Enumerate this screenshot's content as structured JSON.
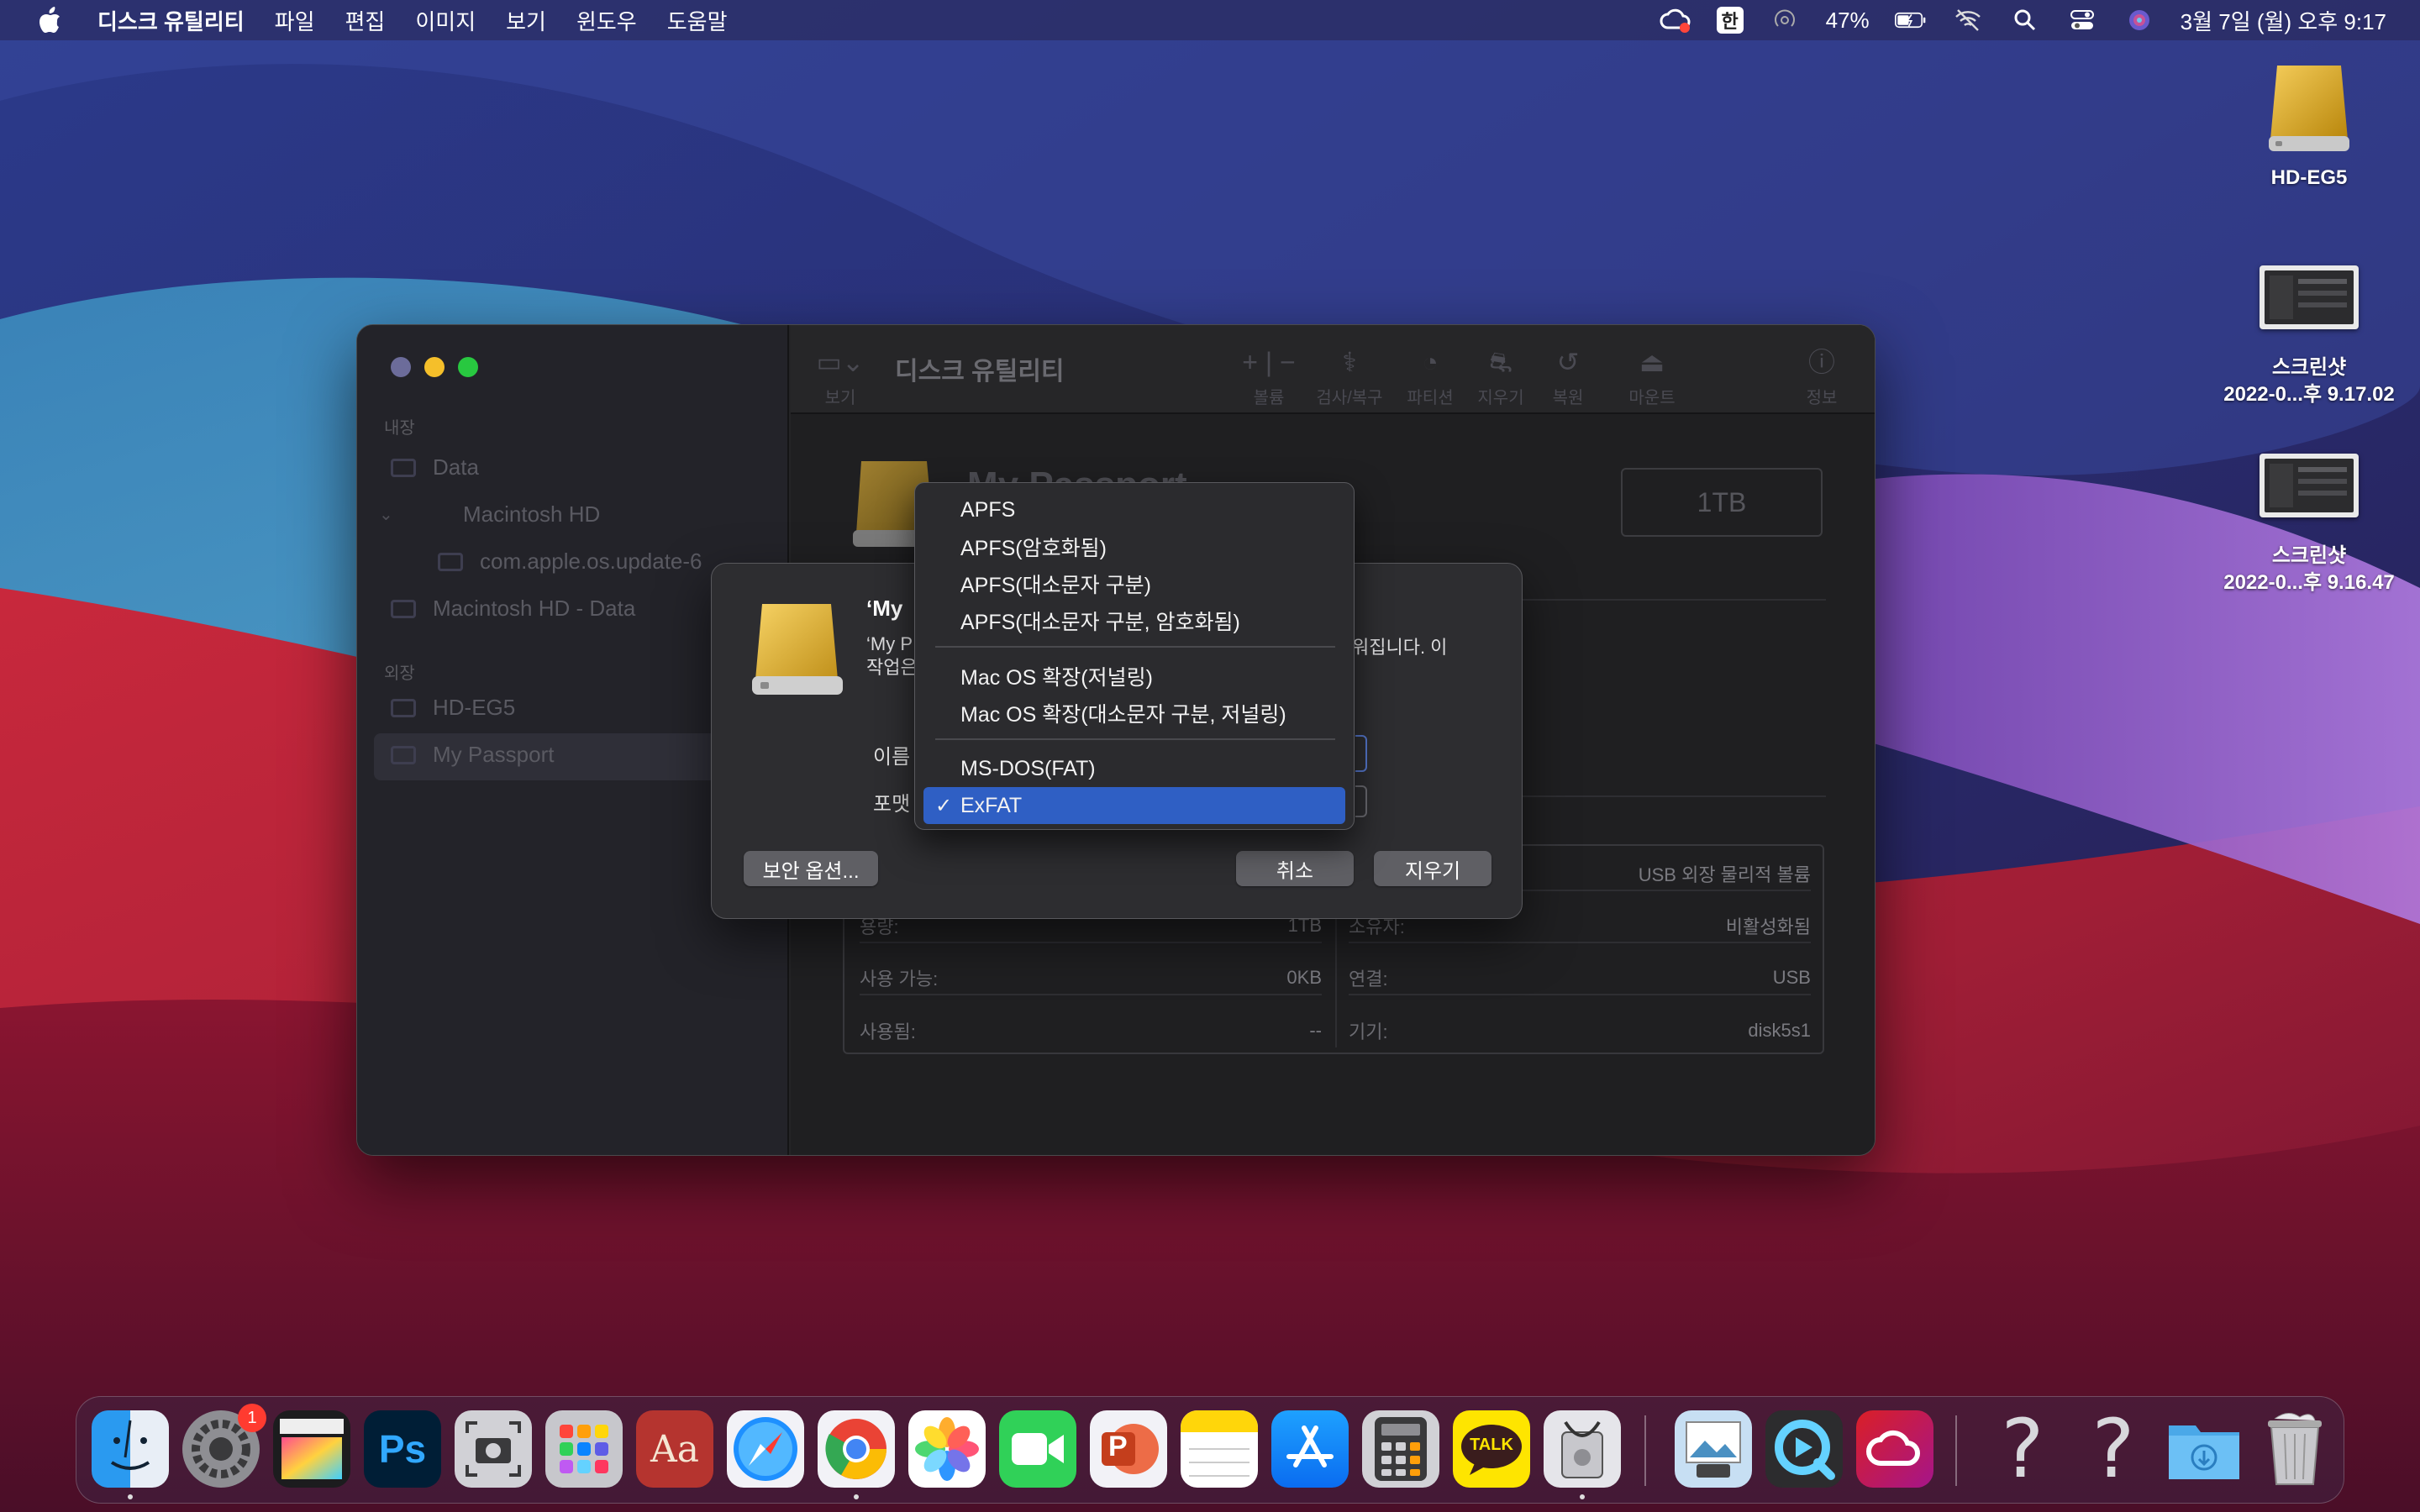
{
  "menubar": {
    "app_name": "디스크 유틸리티",
    "menus": [
      "파일",
      "편집",
      "이미지",
      "보기",
      "윈도우",
      "도움말"
    ],
    "ime_label": "한",
    "battery_percent": "47%",
    "clock": "3월 7일 (월) 오후 9:17"
  },
  "desktop": {
    "icons": [
      {
        "label": "HD-EG5",
        "icon": "external-drive-icon"
      },
      {
        "label_line1": "스크린샷",
        "label_line2": "2022-0...후 9.17.02",
        "icon": "screenshot-file-icon"
      },
      {
        "label_line1": "스크린샷",
        "label_line2": "2022-0...후 9.16.47",
        "icon": "screenshot-file-icon"
      }
    ]
  },
  "window": {
    "title": "디스크 유틸리티",
    "toolbar": {
      "view_label": "보기",
      "volume_label": "볼륨",
      "first_aid_label": "검사/복구",
      "partition_label": "파티션",
      "erase_label": "지우기",
      "restore_label": "복원",
      "mount_label": "마운트",
      "info_label": "정보"
    },
    "sidebar": {
      "internal_section": "내장",
      "external_section": "외장",
      "items": [
        {
          "label": "Data"
        },
        {
          "label": "Macintosh HD"
        },
        {
          "label": "com.apple.os.update-6"
        },
        {
          "label": "Macintosh HD - Data"
        },
        {
          "label": "HD-EG5"
        },
        {
          "label": "My Passport"
        }
      ]
    },
    "volume": {
      "name": "My Passport",
      "capacity": "1TB"
    },
    "info": {
      "left": [
        {
          "label": "용량:",
          "value": "1TB"
        },
        {
          "label": "사용 가능:",
          "value": "0KB"
        },
        {
          "label": "사용됨:",
          "value": "--"
        }
      ],
      "right": [
        {
          "label": "",
          "value": "USB 외장 물리적 볼륨"
        },
        {
          "label": "소유자:",
          "value": "비활성화됨"
        },
        {
          "label": "연결:",
          "value": "USB"
        },
        {
          "label": "기기:",
          "value": "disk5s1"
        }
      ]
    }
  },
  "erase_sheet": {
    "title": "‘My",
    "desc_line1": "‘My P",
    "desc_line2": "작업은",
    "desc_tail": "워집니다. 이",
    "name_label": "이름",
    "format_label": "포맷",
    "security_button": "보안 옵션...",
    "cancel_button": "취소",
    "erase_button": "지우기"
  },
  "format_menu": {
    "groups": [
      [
        "APFS",
        "APFS(암호화됨)",
        "APFS(대소문자 구분)",
        "APFS(대소문자 구분, 암호화됨)"
      ],
      [
        "Mac OS 확장(저널링)",
        "Mac OS 확장(대소문자 구분, 저널링)"
      ],
      [
        "MS-DOS(FAT)",
        "ExFAT"
      ]
    ],
    "selected": "ExFAT",
    "check": "✓"
  },
  "dock": {
    "apps": [
      {
        "name": "Finder",
        "icon": "finder-icon"
      },
      {
        "name": "System Preferences",
        "icon": "settings-icon",
        "badge": "1"
      },
      {
        "name": "Final Cut Pro",
        "icon": "final-cut-icon"
      },
      {
        "name": "Photoshop",
        "icon": "photoshop-icon",
        "text": "Ps"
      },
      {
        "name": "Screenshot",
        "icon": "screenshot-icon"
      },
      {
        "name": "Launchpad",
        "icon": "launchpad-icon"
      },
      {
        "name": "Dictionary",
        "icon": "dictionary-icon",
        "text": "Aa"
      },
      {
        "name": "Safari",
        "icon": "safari-icon"
      },
      {
        "name": "Chrome",
        "icon": "chrome-icon"
      },
      {
        "name": "Photos",
        "icon": "photos-icon"
      },
      {
        "name": "FaceTime",
        "icon": "facetime-icon"
      },
      {
        "name": "PowerPoint",
        "icon": "powerpoint-icon",
        "text": "P"
      },
      {
        "name": "Notes",
        "icon": "notes-icon"
      },
      {
        "name": "App Store",
        "icon": "app-store-icon"
      },
      {
        "name": "Calculator",
        "icon": "calculator-icon"
      },
      {
        "name": "KakaoTalk",
        "icon": "kakaotalk-icon",
        "text": "TALK"
      },
      {
        "name": "Disk Utility",
        "icon": "disk-utility-icon"
      },
      {
        "name": "Preview",
        "icon": "preview-icon"
      },
      {
        "name": "QuickTime",
        "icon": "quicktime-icon"
      },
      {
        "name": "Creative Cloud",
        "icon": "creative-cloud-icon"
      },
      {
        "name": "Unknown 1",
        "icon": "question-icon",
        "text": "?"
      },
      {
        "name": "Unknown 2",
        "icon": "question-icon",
        "text": "?"
      },
      {
        "name": "Downloads",
        "icon": "downloads-folder-icon"
      },
      {
        "name": "Trash",
        "icon": "trash-icon"
      }
    ]
  }
}
